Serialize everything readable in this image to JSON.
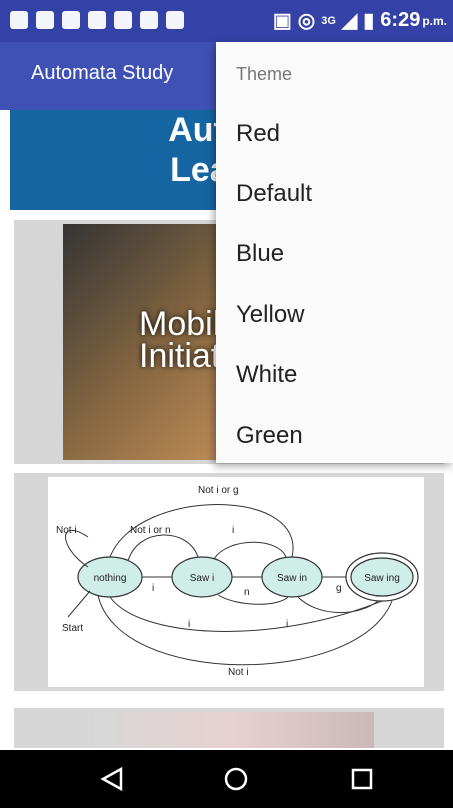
{
  "status_bar": {
    "time": "6:29",
    "ampm": "p.m.",
    "network": "3G"
  },
  "app_bar": {
    "title": "Automata Study"
  },
  "banner": {
    "line1": "Automa",
    "line2": "Learnin"
  },
  "cards": [
    {
      "image_text_line1": "Mobile",
      "image_text_line2": "Initiativ"
    },
    {
      "diagram": {
        "states": [
          "nothing",
          "Saw i",
          "Saw in",
          "Saw ing"
        ],
        "labels": [
          "Not i or g",
          "Not i",
          "Not i or n",
          "i",
          "i",
          "n",
          "g",
          "i",
          "i",
          "Start",
          "Not i"
        ]
      }
    },
    {}
  ],
  "menu": {
    "header": "Theme",
    "items": [
      "Red",
      "Default",
      "Blue",
      "Yellow",
      "White",
      "Green"
    ]
  },
  "colors": {
    "status_bar": "#3441a6",
    "app_bar": "#3f51b5",
    "banner": "#1565a3",
    "menu_bg": "#fafafa"
  }
}
